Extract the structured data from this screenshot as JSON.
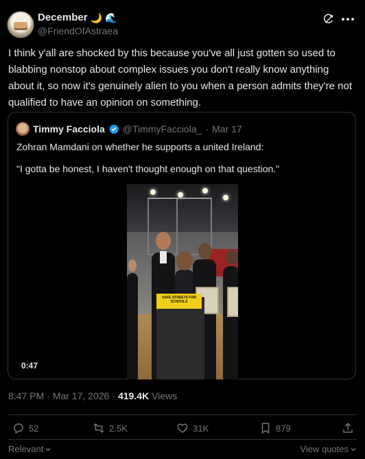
{
  "author": {
    "display_name": "December",
    "emoji_1": "🌙",
    "emoji_2": "🌊",
    "handle": "@FriendOfAstraea"
  },
  "tweet": {
    "text": "I think y'all are shocked by this because you've all just gotten so used to blabbing nonstop about complex issues you don't really know anything about it, so now it's genuinely alien to you when a person admits they're not qualified to have an opinion on something."
  },
  "quote": {
    "name": "Timmy Facciola",
    "handle": "@TimmyFacciola_",
    "separator": "·",
    "date": "Mar 17",
    "line1": "Zohran Mamdani on whether he supports a united Ireland:",
    "line2": "\"I gotta be honest, I haven't thought enough on that question.\"",
    "video": {
      "duration": "0:47",
      "sign_text": "SAFE STREETS FOR SCHOOLS"
    }
  },
  "meta": {
    "time": "8:47 PM",
    "dot": "·",
    "date": "Mar 17, 2026",
    "dot2": "·",
    "views_count": "419.4K",
    "views_label": "Views"
  },
  "actions": {
    "replies": "52",
    "reposts": "2.5K",
    "likes": "31K",
    "bookmarks": "879"
  },
  "footer": {
    "sort_label": "Relevant",
    "view_quotes": "View quotes"
  },
  "colors": {
    "background": "#000000",
    "text": "#e7e9ea",
    "muted": "#71767b",
    "border": "#2f3336",
    "verified": "#1d9bf0"
  },
  "icons": [
    "grok-icon",
    "more-icon",
    "verified-icon",
    "reply-icon",
    "repost-icon",
    "like-icon",
    "bookmark-icon",
    "share-icon",
    "chevron-down-icon"
  ]
}
